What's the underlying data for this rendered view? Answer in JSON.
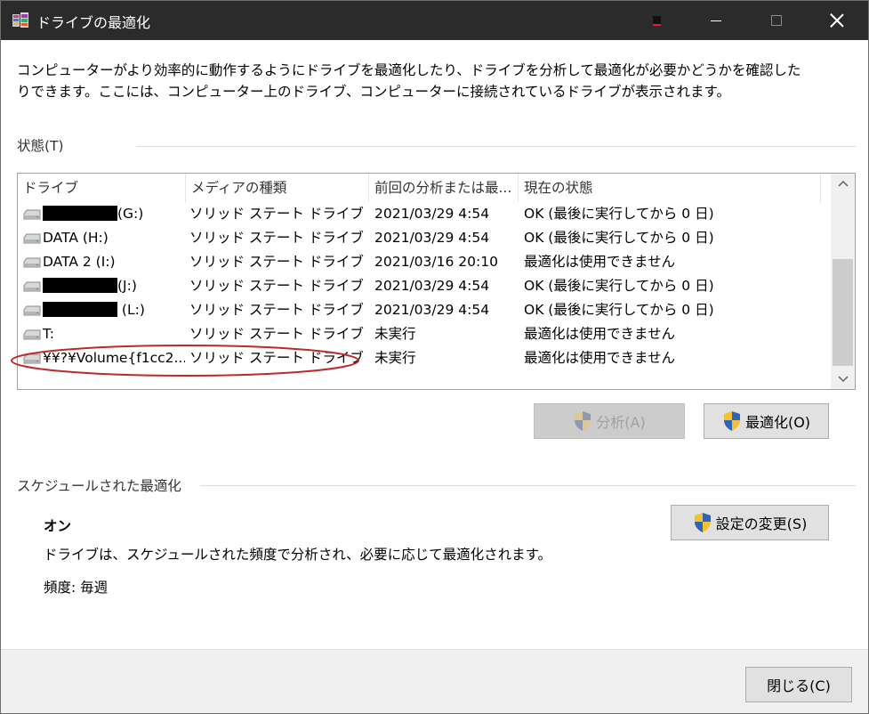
{
  "window": {
    "title": "ドライブの最適化"
  },
  "description": "コンピューターがより効率的に動作するようにドライブを最適化したり、ドライブを分析して最適化が必要かどうかを確認したりできます。ここには、コンピューター上のドライブ、コンピューターに接続されているドライブが表示されます。",
  "status_section": {
    "label": "状態(T)"
  },
  "drive_list": {
    "columns": [
      "ドライブ",
      "メディアの種類",
      "前回の分析または最...",
      "現在の状態"
    ],
    "rows": [
      {
        "drive": "(G:)",
        "redacted": true,
        "media": "ソリッド ステート ドライブ",
        "last": "2021/03/29 4:54",
        "status": "OK (最後に実行してから 0 日)"
      },
      {
        "drive": "DATA (H:)",
        "redacted": false,
        "media": "ソリッド ステート ドライブ",
        "last": "2021/03/29 4:54",
        "status": "OK (最後に実行してから 0 日)"
      },
      {
        "drive": "DATA 2 (I:)",
        "redacted": false,
        "media": "ソリッド ステート ドライブ",
        "last": "2021/03/16 20:10",
        "status": "最適化は使用できません"
      },
      {
        "drive": "(J:)",
        "redacted": true,
        "media": "ソリッド ステート ドライブ",
        "last": "2021/03/29 4:54",
        "status": "OK (最後に実行してから 0 日)"
      },
      {
        "drive": " (L:)",
        "redacted": true,
        "media": "ソリッド ステート ドライブ",
        "last": "2021/03/29 4:54",
        "status": "OK (最後に実行してから 0 日)"
      },
      {
        "drive": "T:",
        "redacted": false,
        "media": "ソリッド ステート ドライブ",
        "last": "未実行",
        "status": "最適化は使用できません"
      },
      {
        "drive": "¥¥?¥Volume{f1cc2...",
        "redacted": false,
        "media": "ソリッド ステート ドライブ",
        "last": "未実行",
        "status": "最適化は使用できません"
      }
    ]
  },
  "buttons": {
    "analyze": "分析(A)",
    "optimize": "最適化(O)",
    "change_settings": "設定の変更(S)",
    "close": "閉じる(C)"
  },
  "schedule": {
    "label": "スケジュールされた最適化",
    "state": "オン",
    "description": "ドライブは、スケジュールされた頻度で分析され、必要に応じて最適化されます。",
    "frequency": "頻度: 毎週"
  },
  "colors": {
    "titlebar": "#2b2b2b",
    "annotation": "#c0282d",
    "button_face": "#e1e1e1"
  }
}
